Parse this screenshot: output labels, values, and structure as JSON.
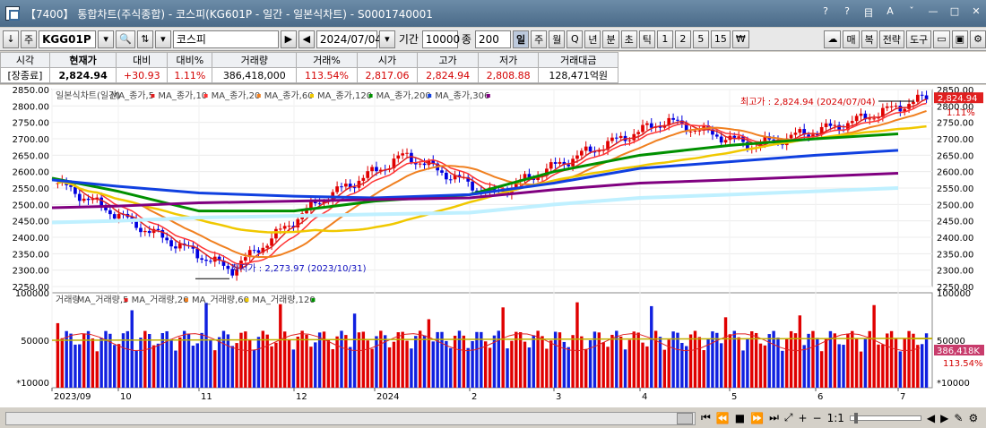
{
  "window": {
    "title": "【7400】 통합차트(주식종합) - 코스피(KG601P - 일간 - 일본식차트) - S0001740001",
    "controls": [
      "?",
      "?",
      "目",
      "A",
      "ˇ",
      "—",
      "□",
      "✕"
    ]
  },
  "toolbar": {
    "code": "KGG01P",
    "market_label": "주",
    "name": "코스피",
    "date": "2024/07/04",
    "period_label": "기간",
    "period_value": "10000",
    "count_label": "종",
    "count_value": "200",
    "freq_buttons": [
      "일",
      "주",
      "월",
      "Q",
      "년",
      "분",
      "초",
      "틱",
      "1",
      "2",
      "5",
      "15",
      "₩"
    ],
    "active_freq": "일",
    "right_buttons": [
      "매",
      "복",
      "전략",
      "도구"
    ]
  },
  "quote": {
    "headers": [
      "시각",
      "현재가",
      "대비",
      "대비%",
      "거래량",
      "거래%",
      "시가",
      "고가",
      "저가",
      "거래대금"
    ],
    "values": [
      "[장종료]",
      "2,824.94",
      "+30.93",
      "1.11%",
      "386,418,000",
      "113.54%",
      "2,817.06",
      "2,824.94",
      "2,808.88",
      "128,471억원"
    ]
  },
  "price_panel": {
    "legend": [
      {
        "name": "일본식차트(일간)",
        "color": "#555555"
      },
      {
        "name": "MA_종가,5",
        "color": "#e02020"
      },
      {
        "name": "MA_종가,10",
        "color": "#ff3333"
      },
      {
        "name": "MA_종가,20",
        "color": "#f08020"
      },
      {
        "name": "MA_종가,60",
        "color": "#f0c800"
      },
      {
        "name": "MA_종가,120",
        "color": "#009000"
      },
      {
        "name": "MA_종가,200",
        "color": "#1040e0"
      },
      {
        "name": "MA_종가,306",
        "color": "#800080"
      }
    ],
    "y_ticks": [
      "2850.00",
      "2800.00",
      "2750.00",
      "2700.00",
      "2650.00",
      "2600.00",
      "2550.00",
      "2500.00",
      "2450.00",
      "2400.00",
      "2350.00",
      "2300.00",
      "2250.00"
    ],
    "high_label": "최고가 : 2,824.94 (2024/07/04)",
    "low_label": "최저가 : 2,273.97 (2023/10/31)",
    "last_price": "2,824.94",
    "change_pct": "1.11%"
  },
  "volume_panel": {
    "legend": [
      {
        "name": "거래량",
        "color": "#555555"
      },
      {
        "name": "MA_거래량,5",
        "color": "#e02020"
      },
      {
        "name": "MA_거래량,20",
        "color": "#f08020"
      },
      {
        "name": "MA_거래량,60",
        "color": "#f0c800"
      },
      {
        "name": "MA_거래량,120",
        "color": "#009000"
      }
    ],
    "y_ticks": [
      "100000",
      "50000"
    ],
    "unit_label": "*10000",
    "last_volume": "386,418K",
    "volume_pct": "113.54%"
  },
  "x_axis": [
    "2023/09",
    "10",
    "11",
    "12",
    "2024",
    "2",
    "3",
    "4",
    "5",
    "6",
    "7"
  ],
  "chart_data": {
    "type": "line",
    "title": "",
    "xlabel": "",
    "ylabel": "",
    "x": [
      "2023/09",
      "10",
      "11",
      "12",
      "2024",
      "2",
      "3",
      "4",
      "5",
      "6",
      "7"
    ],
    "ylim": [
      2250,
      2850
    ],
    "series": [
      {
        "name": "일본식차트(일간)",
        "values": [
          2565,
          2425,
          2300,
          2510,
          2650,
          2530,
          2650,
          2755,
          2680,
          2740,
          2825
        ]
      },
      {
        "name": "MA_종가,120",
        "values": [
          2580,
          2540,
          2480,
          2480,
          2510,
          2530,
          2600,
          2650,
          2680,
          2700,
          2715
        ]
      },
      {
        "name": "MA_종가,200",
        "values": [
          2575,
          2555,
          2535,
          2525,
          2520,
          2530,
          2565,
          2610,
          2630,
          2650,
          2665
        ]
      },
      {
        "name": "MA_종가,306",
        "values": [
          2490,
          2495,
          2505,
          2510,
          2515,
          2520,
          2545,
          2565,
          2575,
          2585,
          2595
        ]
      }
    ],
    "volume": {
      "ylim": [
        0,
        100000
      ],
      "unit": "*10000"
    }
  }
}
